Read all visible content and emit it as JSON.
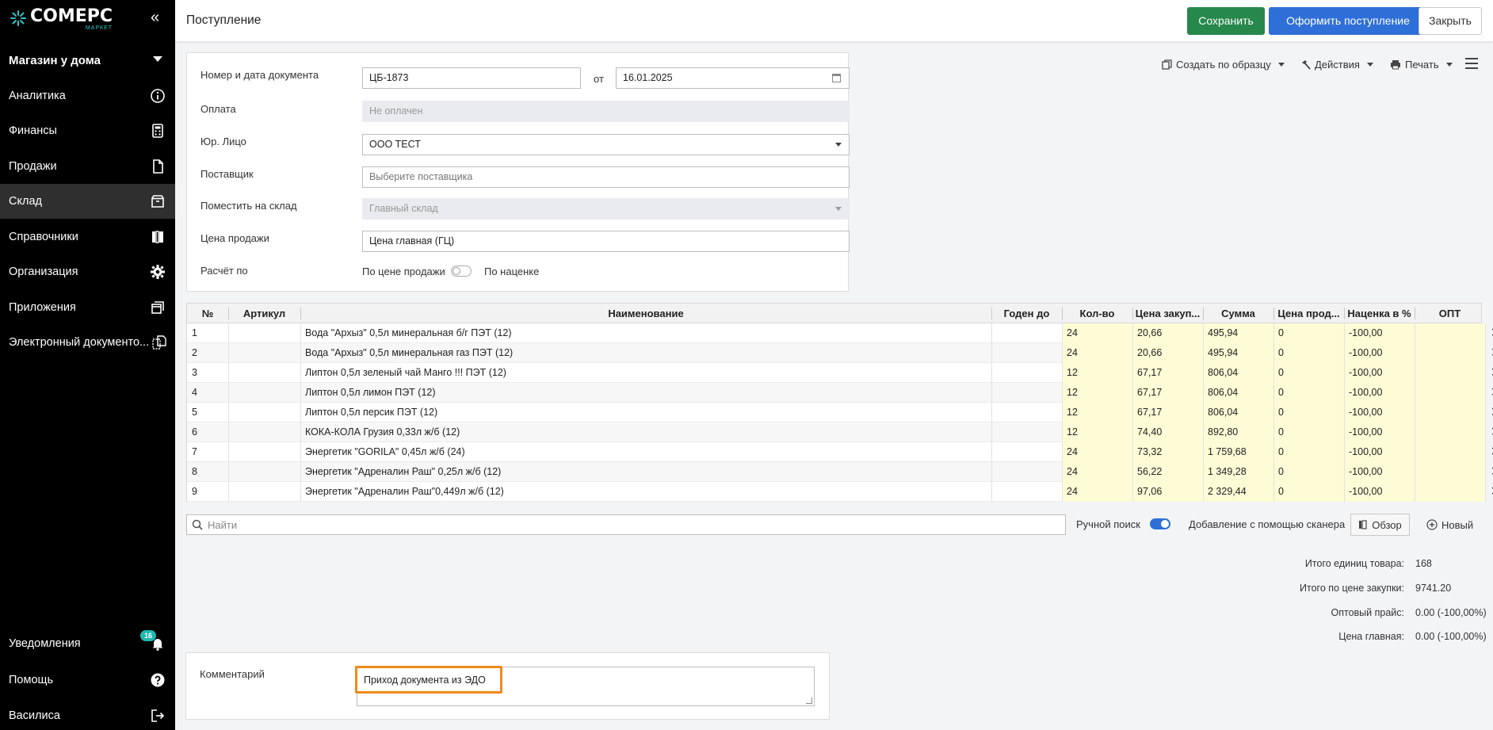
{
  "brand": {
    "name": "COMEPC",
    "sub": "МАРКЕТ"
  },
  "sidebar": {
    "store": "Магазин у дома",
    "items": [
      {
        "label": "Аналитика",
        "icon": "info-icon"
      },
      {
        "label": "Финансы",
        "icon": "calculator-icon"
      },
      {
        "label": "Продажи",
        "icon": "document-icon"
      },
      {
        "label": "Склад",
        "icon": "box-icon",
        "active": true
      },
      {
        "label": "Справочники",
        "icon": "books-icon"
      },
      {
        "label": "Организация",
        "icon": "gear-icon"
      },
      {
        "label": "Приложения",
        "icon": "windows-icon"
      },
      {
        "label": "Электронный документо...",
        "icon": "edo-icon"
      }
    ],
    "bottom": [
      {
        "label": "Уведомления",
        "icon": "bell-icon",
        "badge": "16"
      },
      {
        "label": "Помощь",
        "icon": "help-icon"
      },
      {
        "label": "Василиса",
        "icon": "logout-icon"
      }
    ]
  },
  "header": {
    "title": "Поступление",
    "save_label": "Сохранить",
    "issue_label": "Оформить поступление",
    "close_label": "Закрыть"
  },
  "form": {
    "doc_label": "Номер и дата документа",
    "doc_number": "ЦБ-1873",
    "from_label": "от",
    "doc_date": "16.01.2025",
    "payment_label": "Оплата",
    "payment_value": "Не оплачен",
    "legal_label": "Юр. Лицо",
    "legal_value": "ООО ТЕСТ",
    "supplier_label": "Поставщик",
    "supplier_placeholder": "Выберите поставщика",
    "warehouse_label": "Поместить на склад",
    "warehouse_value": "Главный склад",
    "price_label": "Цена продажи",
    "price_value": "Цена главная (ГЦ)",
    "calc_label": "Расчёт по",
    "calc_option_a": "По цене продажи",
    "calc_option_b": "По наценке"
  },
  "actions": {
    "create_by_sample": "Создать по образцу",
    "actions": "Действия",
    "print": "Печать"
  },
  "table": {
    "columns": [
      "№",
      "Артикул",
      "Наименование",
      "Годен до",
      "Кол-во",
      "Цена закуп...",
      "Сумма",
      "Цена прод...",
      "Наценка в %",
      "ОПТ"
    ],
    "rows": [
      {
        "n": "1",
        "sku": "",
        "name": "Вода \"Архыз\" 0,5л минеральная б/г ПЭТ (12)",
        "exp": "",
        "qty": "24",
        "cost": "20,66",
        "sum": "495,94",
        "sale": "0",
        "markup": "-100,00",
        "opt": ""
      },
      {
        "n": "2",
        "sku": "",
        "name": "Вода \"Архыз\" 0,5л минеральная газ ПЭТ (12)",
        "exp": "",
        "qty": "24",
        "cost": "20,66",
        "sum": "495,94",
        "sale": "0",
        "markup": "-100,00",
        "opt": ""
      },
      {
        "n": "3",
        "sku": "",
        "name": "Липтон 0,5л зеленый чай Манго !!! ПЭТ (12)",
        "exp": "",
        "qty": "12",
        "cost": "67,17",
        "sum": "806,04",
        "sale": "0",
        "markup": "-100,00",
        "opt": ""
      },
      {
        "n": "4",
        "sku": "",
        "name": "Липтон 0,5л лимон ПЭТ (12)",
        "exp": "",
        "qty": "12",
        "cost": "67,17",
        "sum": "806,04",
        "sale": "0",
        "markup": "-100,00",
        "opt": ""
      },
      {
        "n": "5",
        "sku": "",
        "name": "Липтон 0,5л персик ПЭТ (12)",
        "exp": "",
        "qty": "12",
        "cost": "67,17",
        "sum": "806,04",
        "sale": "0",
        "markup": "-100,00",
        "opt": ""
      },
      {
        "n": "6",
        "sku": "",
        "name": "КОКА-КОЛА Грузия 0,33л ж/б (12)",
        "exp": "",
        "qty": "12",
        "cost": "74,40",
        "sum": "892,80",
        "sale": "0",
        "markup": "-100,00",
        "opt": ""
      },
      {
        "n": "7",
        "sku": "",
        "name": "Энергетик \"GORILA\" 0,45л ж/б (24)",
        "exp": "",
        "qty": "24",
        "cost": "73,32",
        "sum": "1 759,68",
        "sale": "0",
        "markup": "-100,00",
        "opt": ""
      },
      {
        "n": "8",
        "sku": "",
        "name": "Энергетик \"Адреналин Раш\" 0,25л ж/б (12)",
        "exp": "",
        "qty": "24",
        "cost": "56,22",
        "sum": "1 349,28",
        "sale": "0",
        "markup": "-100,00",
        "opt": ""
      },
      {
        "n": "9",
        "sku": "",
        "name": "Энергетик \"Адреналин Раш\"0,449л ж/б (12)",
        "exp": "",
        "qty": "24",
        "cost": "97,06",
        "sum": "2 329,44",
        "sale": "0",
        "markup": "-100,00",
        "opt": ""
      }
    ],
    "delete_glyph": "✕"
  },
  "search": {
    "placeholder": "Найти",
    "manual_search": "Ручной поиск",
    "scanner_label": "Добавление с помощью сканера",
    "browse": "Обзор",
    "new": "Новый"
  },
  "totals": [
    {
      "label": "Итого единиц товара:",
      "value": "168"
    },
    {
      "label": "Итого по цене закупки:",
      "value": "9741.20"
    },
    {
      "label": "Оптовый прайс:",
      "value": "0.00 (-100,00%)"
    },
    {
      "label": "Цена главная:",
      "value": "0.00 (-100,00%)"
    }
  ],
  "comment": {
    "label": "Комментарий",
    "value": "Приход документа из ЭДО",
    "highlight_color": "#f08a1a"
  },
  "colors": {
    "save": "#27884b",
    "primary": "#2f6fd8",
    "sidebar": "#000000",
    "editable_cells": "#fefcd6"
  }
}
